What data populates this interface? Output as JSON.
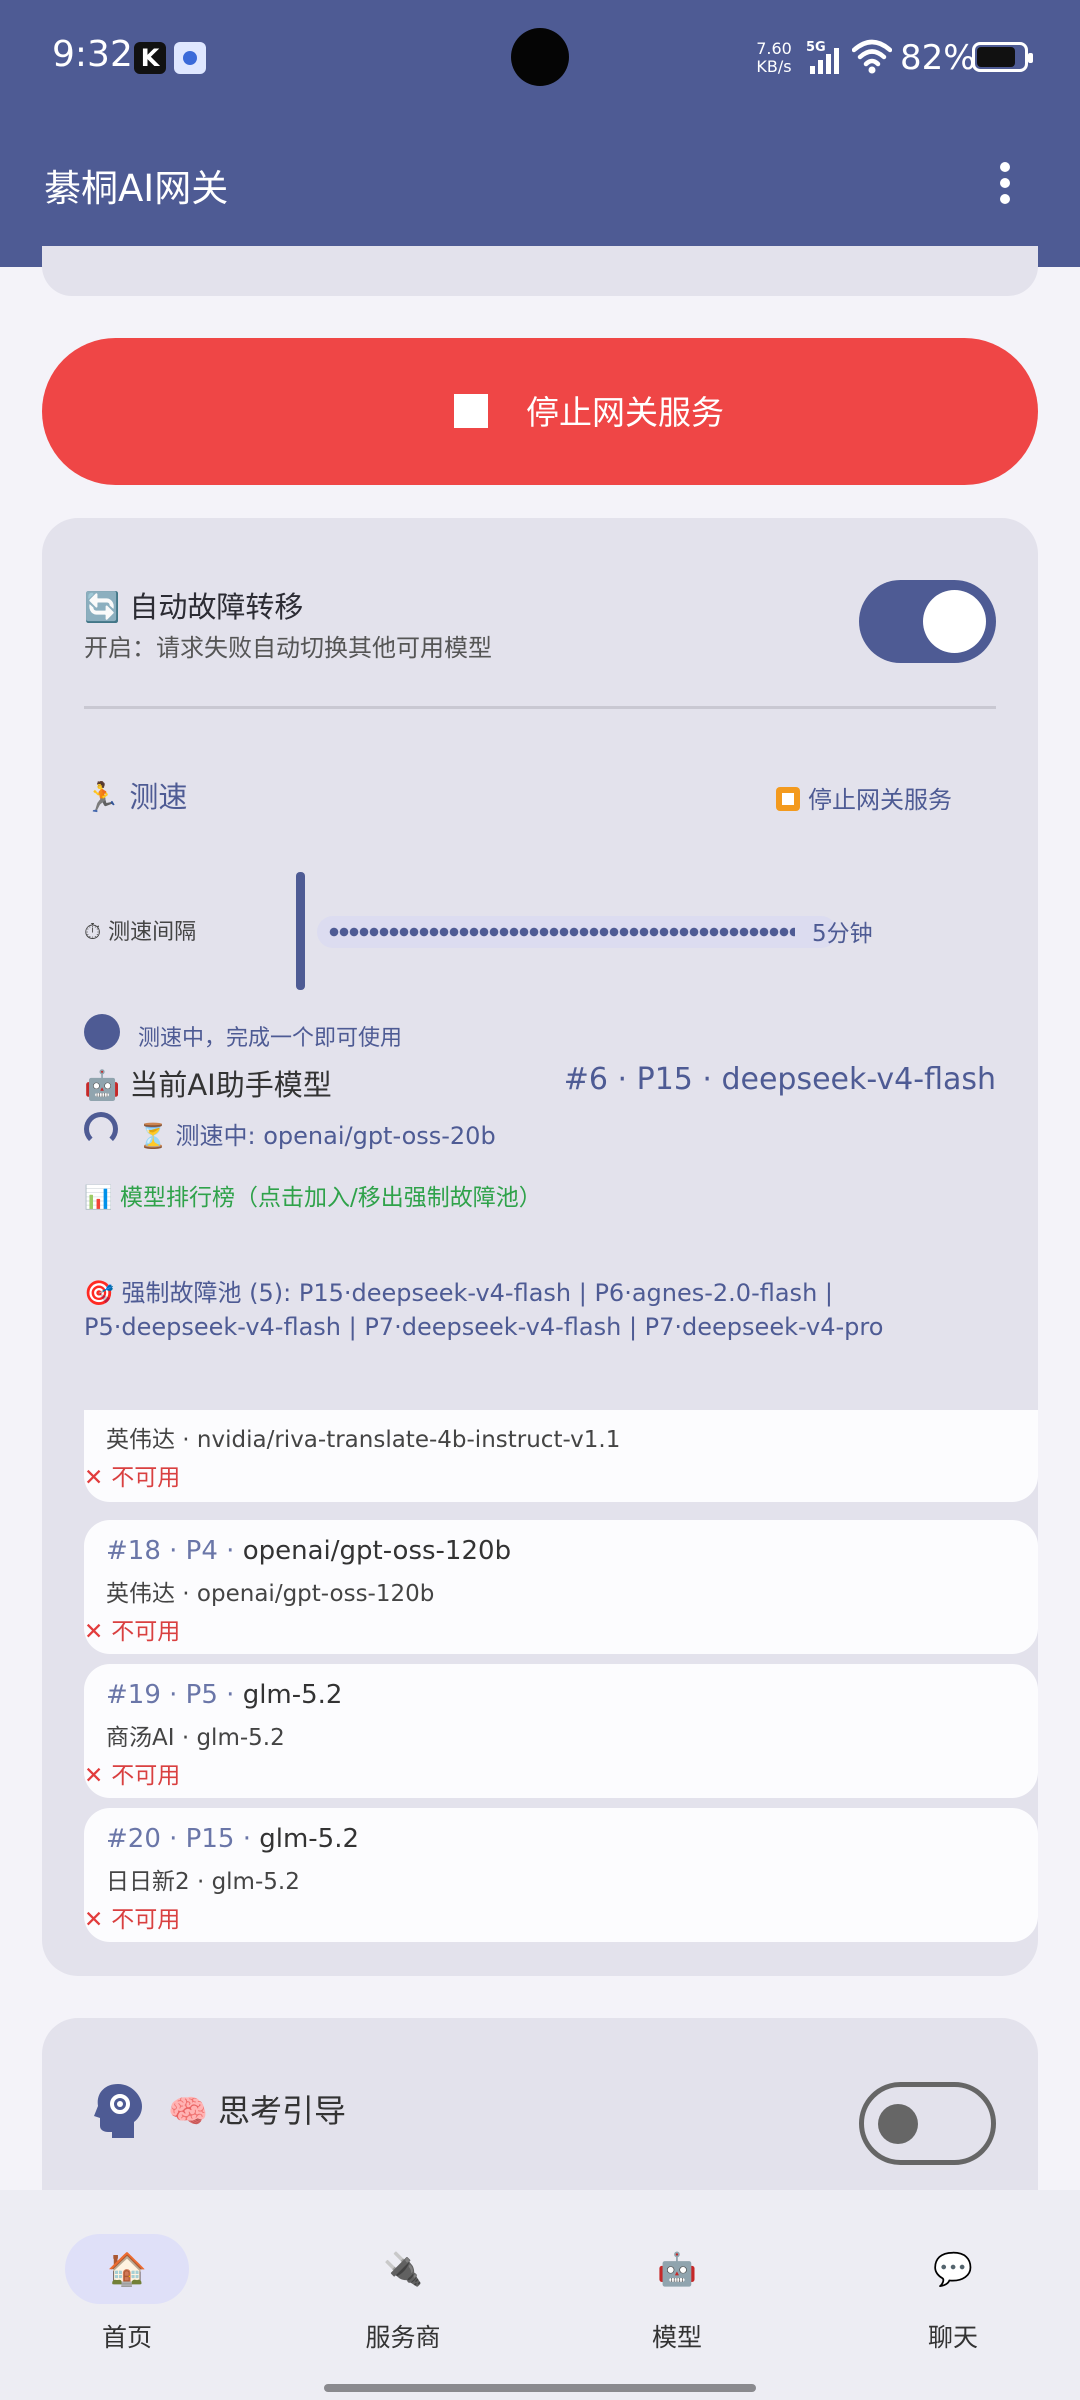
{
  "status_bar": {
    "time": "9:32",
    "k_app_letter": "K",
    "net_speed_value": "7.60",
    "net_speed_unit": "KB/s",
    "network_type": "5G",
    "battery": "82%"
  },
  "app_bar": {
    "title": "綦桐AI网关",
    "menu_icon": "more-vert-icon"
  },
  "gateway": {
    "stop_button_label": "停止网关服务"
  },
  "failover": {
    "icon": "🔄",
    "title": "自动故障转移",
    "description": "开启：请求失败自动切换其他可用模型",
    "enabled": true
  },
  "speed_test": {
    "icon": "🏃",
    "title": "测速",
    "stop_link": "停止网关服务",
    "interval_label": "⏱ 测速间隔",
    "interval_value": "5分钟",
    "testing_note": "测速中，完成一个即可使用",
    "assistant_label": "🤖 当前AI助手模型",
    "assistant_value": "#6 · P15 · deepseek-v4-flash",
    "current_testing": "⏳ 测速中: openai/gpt-oss-20b",
    "ranking_link": "📊 模型排行榜（点击加入/移出强制故障池）",
    "force_pool": "🎯 强制故障池 (5): P15·deepseek-v4-flash | P6·agnes-2.0-flash | P5·deepseek-v4-flash | P7·deepseek-v4-flash | P7·deepseek-v4-pro"
  },
  "ranking": {
    "partial_item": {
      "sub": "英伟达 · nvidia/riva-translate-4b-instruct-v1.1",
      "status": "不可用"
    },
    "items": [
      {
        "rank": "#18 · P4 · ",
        "model": "openai/gpt-oss-120b",
        "sub": "英伟达 · openai/gpt-oss-120b",
        "status": "不可用"
      },
      {
        "rank": "#19 · P5 · ",
        "model": "glm-5.2",
        "sub": "商汤AI · glm-5.2",
        "status": "不可用"
      },
      {
        "rank": "#20 · P15 · ",
        "model": "glm-5.2",
        "sub": "日日新2 · glm-5.2",
        "status": "不可用"
      }
    ]
  },
  "thinking": {
    "icon": "🧠",
    "title": "思考引导",
    "enabled": false
  },
  "bottom_nav": [
    {
      "icon": "🏠",
      "label": "首页",
      "active": true
    },
    {
      "icon": "🔌",
      "label": "服务商",
      "active": false
    },
    {
      "icon": "🤖",
      "label": "模型",
      "active": false
    },
    {
      "icon": "💬",
      "label": "聊天",
      "active": false
    }
  ],
  "colors": {
    "primary": "#4e5b94",
    "danger": "#ef4646",
    "success": "#2fa24a",
    "surface": "#e3e2ec"
  }
}
